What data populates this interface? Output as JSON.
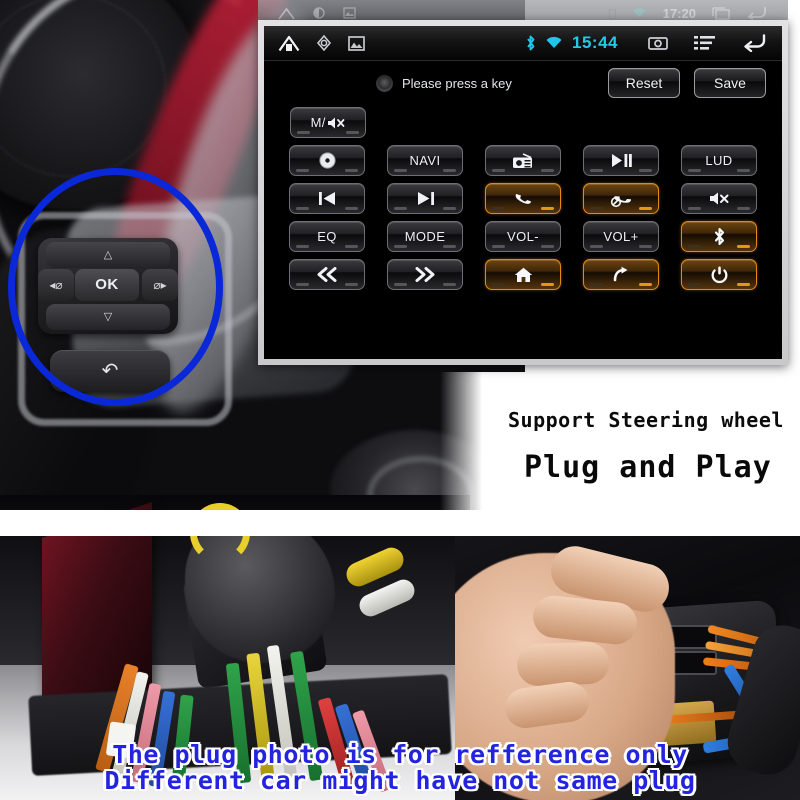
{
  "ghost_bar": {
    "time": "17:20",
    "icons": [
      "home-icon",
      "brightness-icon",
      "image-icon",
      "battery-icon",
      "wifi-icon",
      "recents-icon",
      "back-icon"
    ]
  },
  "head_unit": {
    "navbar": {
      "left_icons": [
        "home-icon",
        "compass-icon",
        "gallery-icon"
      ],
      "bluetooth_icon": "bluetooth-icon",
      "wifi_icon": "wifi-icon",
      "clock": "15:44",
      "right_icons": [
        "screenshot-icon",
        "menu-icon",
        "back-icon"
      ]
    },
    "header": {
      "status_icon": "record-dot-icon",
      "status_text": "Please press a key",
      "reset_label": "Reset",
      "save_label": "Save"
    },
    "key_grid": {
      "rows": [
        [
          {
            "label": "M/",
            "icon": "mute-icon",
            "highlighted": false,
            "name": "mute-toggle-button"
          }
        ],
        [
          {
            "label": "",
            "icon": "disc-icon",
            "highlighted": false,
            "name": "disc-button"
          },
          {
            "label": "NAVI",
            "icon": "",
            "highlighted": false,
            "name": "navi-button"
          },
          {
            "label": "",
            "icon": "radio-icon",
            "highlighted": false,
            "name": "radio-button"
          },
          {
            "label": "",
            "icon": "play-pause-icon",
            "highlighted": false,
            "name": "play-pause-button"
          },
          {
            "label": "LUD",
            "icon": "",
            "highlighted": false,
            "name": "lud-button"
          }
        ],
        [
          {
            "label": "",
            "icon": "previous-track-icon",
            "highlighted": false,
            "name": "previous-button"
          },
          {
            "label": "",
            "icon": "next-track-icon",
            "highlighted": false,
            "name": "next-button"
          },
          {
            "label": "",
            "icon": "phone-answer-icon",
            "highlighted": true,
            "name": "phone-answer-button"
          },
          {
            "label": "",
            "icon": "phone-hangup-icon",
            "highlighted": true,
            "name": "phone-hangup-button"
          },
          {
            "label": "",
            "icon": "mute-icon",
            "highlighted": false,
            "name": "mute-button"
          }
        ],
        [
          {
            "label": "EQ",
            "icon": "",
            "highlighted": false,
            "name": "eq-button"
          },
          {
            "label": "MODE",
            "icon": "",
            "highlighted": false,
            "name": "mode-button"
          },
          {
            "label": "VOL-",
            "icon": "",
            "highlighted": false,
            "name": "volume-down-button"
          },
          {
            "label": "VOL+",
            "icon": "",
            "highlighted": false,
            "name": "volume-up-button"
          },
          {
            "label": "",
            "icon": "bluetooth-icon",
            "highlighted": true,
            "name": "bluetooth-button"
          }
        ],
        [
          {
            "label": "",
            "icon": "rewind-icon",
            "highlighted": false,
            "name": "rewind-button"
          },
          {
            "label": "",
            "icon": "fast-forward-icon",
            "highlighted": false,
            "name": "fast-forward-button"
          },
          {
            "label": "",
            "icon": "home-icon",
            "highlighted": true,
            "name": "home-button"
          },
          {
            "label": "",
            "icon": "return-icon",
            "highlighted": true,
            "name": "return-button"
          },
          {
            "label": "",
            "icon": "power-icon",
            "highlighted": true,
            "name": "power-button"
          }
        ]
      ]
    }
  },
  "steering_wheel": {
    "ok_label": "OK",
    "up_label": "△",
    "down_label": "▽",
    "left_label": "◂⌀",
    "right_label": "⌀▸",
    "back_label": "↶",
    "highlight_color": "#0a27d8"
  },
  "promo": {
    "support_line": "Support Steering wheel",
    "plug_and_play": "Plug and Play"
  },
  "caption": {
    "line1": "The plug photo is for refference only",
    "line2": "Different car might have not same plug",
    "color": "#2323e0",
    "outline_color": "#ffffff"
  }
}
